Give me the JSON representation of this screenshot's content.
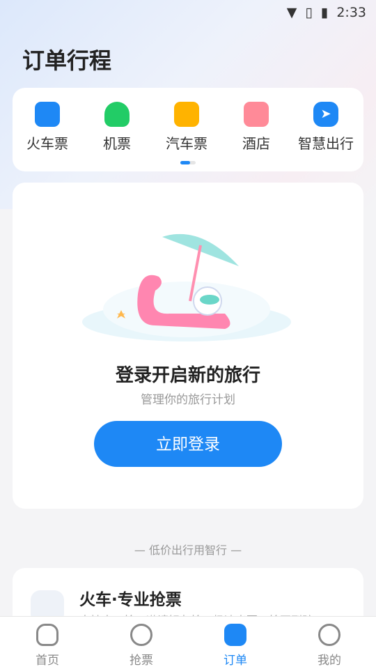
{
  "status": {
    "time": "2:33",
    "icons": [
      "wifi-icon",
      "no-sim-icon",
      "battery-charging-icon"
    ]
  },
  "header": {
    "title": "订单行程"
  },
  "categories": [
    {
      "label": "火车票",
      "icon": "train-icon",
      "color": "#1e88f5"
    },
    {
      "label": "机票",
      "icon": "plane-icon",
      "color": "#22cc66"
    },
    {
      "label": "汽车票",
      "icon": "bus-icon",
      "color": "#ffb300"
    },
    {
      "label": "酒店",
      "icon": "hotel-icon",
      "color": "#ff7a8a"
    },
    {
      "label": "智慧出行",
      "icon": "navigation-icon",
      "color": "#1e88f5"
    }
  ],
  "login_card": {
    "title": "登录开启新的旅行",
    "subtitle": "管理你的旅行计划",
    "button": "立即登录"
  },
  "slogan": "— 低价出行用智行 —",
  "promo": {
    "title": "火车·专业抢票",
    "desc": "支持人工抢、邀请好友抢、极速出票、抢不到赔"
  },
  "nav": [
    {
      "label": "首页",
      "icon": "home-icon"
    },
    {
      "label": "抢票",
      "icon": "lightning-icon"
    },
    {
      "label": "订单",
      "icon": "order-icon",
      "active": true
    },
    {
      "label": "我的",
      "icon": "profile-icon"
    }
  ]
}
